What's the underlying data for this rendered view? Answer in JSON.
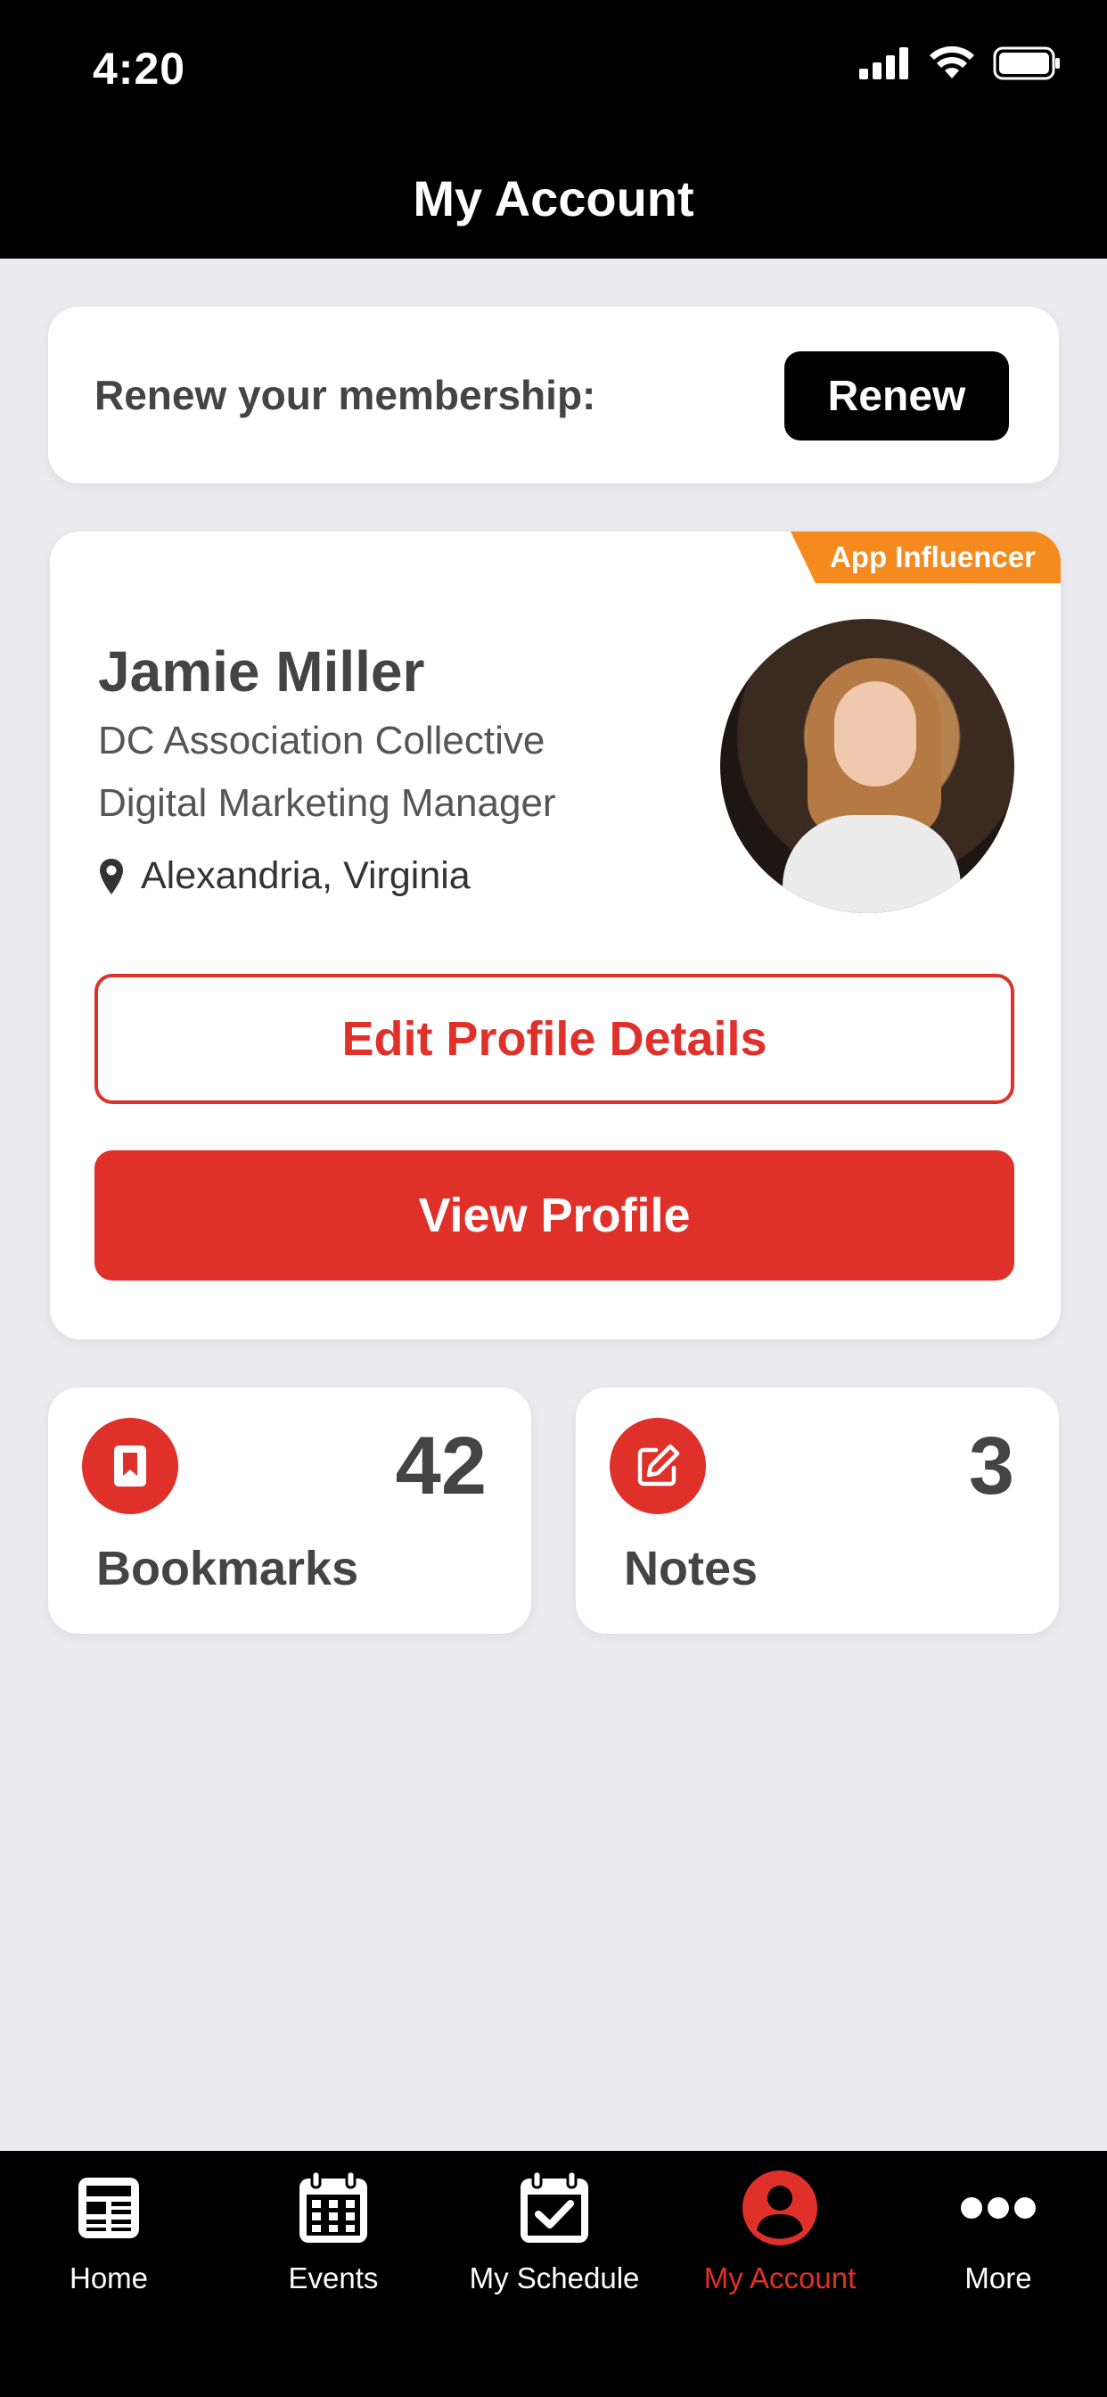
{
  "status_bar": {
    "time": "4:20"
  },
  "header": {
    "title": "My Account"
  },
  "renew": {
    "label": "Renew your membership:",
    "button": "Renew"
  },
  "profile": {
    "badge": "App Influencer",
    "name": "Jamie Miller",
    "organization": "DC Association Collective",
    "role": "Digital Marketing Manager",
    "location": "Alexandria, Virginia",
    "edit_button": "Edit Profile Details",
    "view_button": "View Profile"
  },
  "stats": [
    {
      "count": "42",
      "label": "Bookmarks",
      "icon": "bookmark-icon"
    },
    {
      "count": "3",
      "label": "Notes",
      "icon": "edit-note-icon"
    }
  ],
  "tabs": [
    {
      "label": "Home",
      "icon": "news-icon",
      "active": false
    },
    {
      "label": "Events",
      "icon": "calendar-icon",
      "active": false
    },
    {
      "label": "My Schedule",
      "icon": "calendar-check-icon",
      "active": false
    },
    {
      "label": "My Account",
      "icon": "user-icon",
      "active": true
    },
    {
      "label": "More",
      "icon": "more-icon",
      "active": false
    }
  ],
  "colors": {
    "accent": "#e0302a",
    "badge": "#f58a1f",
    "background": "#ebebef",
    "bars": "#000000"
  }
}
